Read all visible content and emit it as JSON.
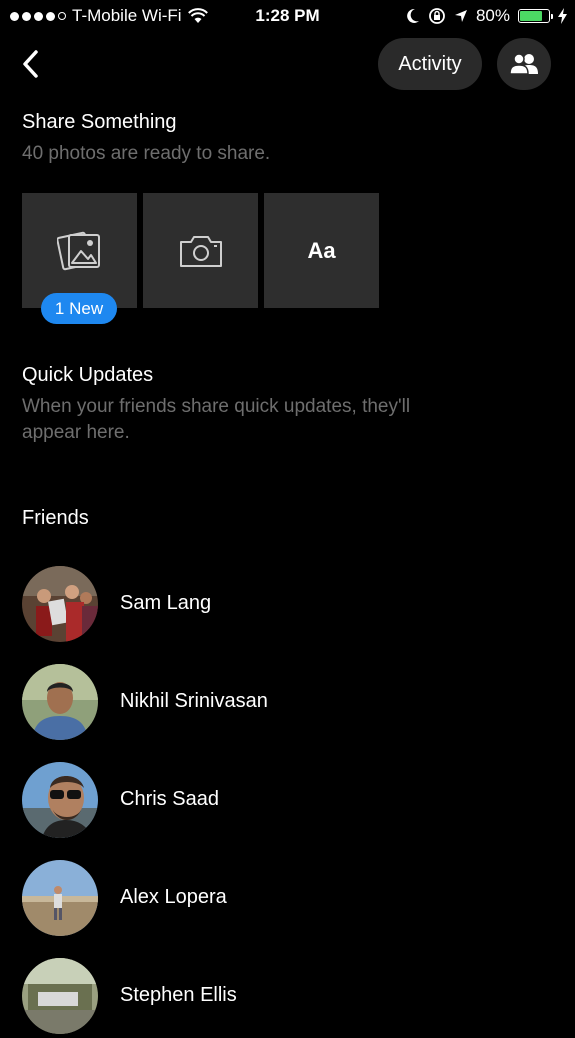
{
  "status_bar": {
    "carrier": "T-Mobile Wi-Fi",
    "time": "1:28 PM",
    "battery": "80%",
    "battery_level": 0.8,
    "icons": [
      "wifi-icon",
      "moon-icon",
      "rotation-lock-icon",
      "location-arrow-icon",
      "battery-icon",
      "charging-bolt-icon"
    ]
  },
  "nav": {
    "activity_label": "Activity",
    "back_icon": "chevron-left-icon",
    "friends_icon": "people-icon"
  },
  "share": {
    "title": "Share Something",
    "subtitle": "40 photos are ready to share.",
    "tiles": [
      {
        "icon": "photos-icon"
      },
      {
        "icon": "camera-icon"
      },
      {
        "label": "Aa"
      }
    ],
    "badge": "1 New"
  },
  "quick_updates": {
    "title": "Quick Updates",
    "subtitle": "When your friends share quick updates, they'll appear here."
  },
  "friends": {
    "title": "Friends",
    "items": [
      {
        "name": "Sam Lang"
      },
      {
        "name": "Nikhil Srinivasan"
      },
      {
        "name": "Chris Saad"
      },
      {
        "name": "Alex Lopera"
      },
      {
        "name": "Stephen Ellis"
      }
    ]
  },
  "colors": {
    "background": "#000000",
    "tile": "#2e2e2e",
    "button": "#2a2a2a",
    "badge": "#1e88f0",
    "muted_text": "#6e6e6e",
    "battery": "#4cd964"
  }
}
